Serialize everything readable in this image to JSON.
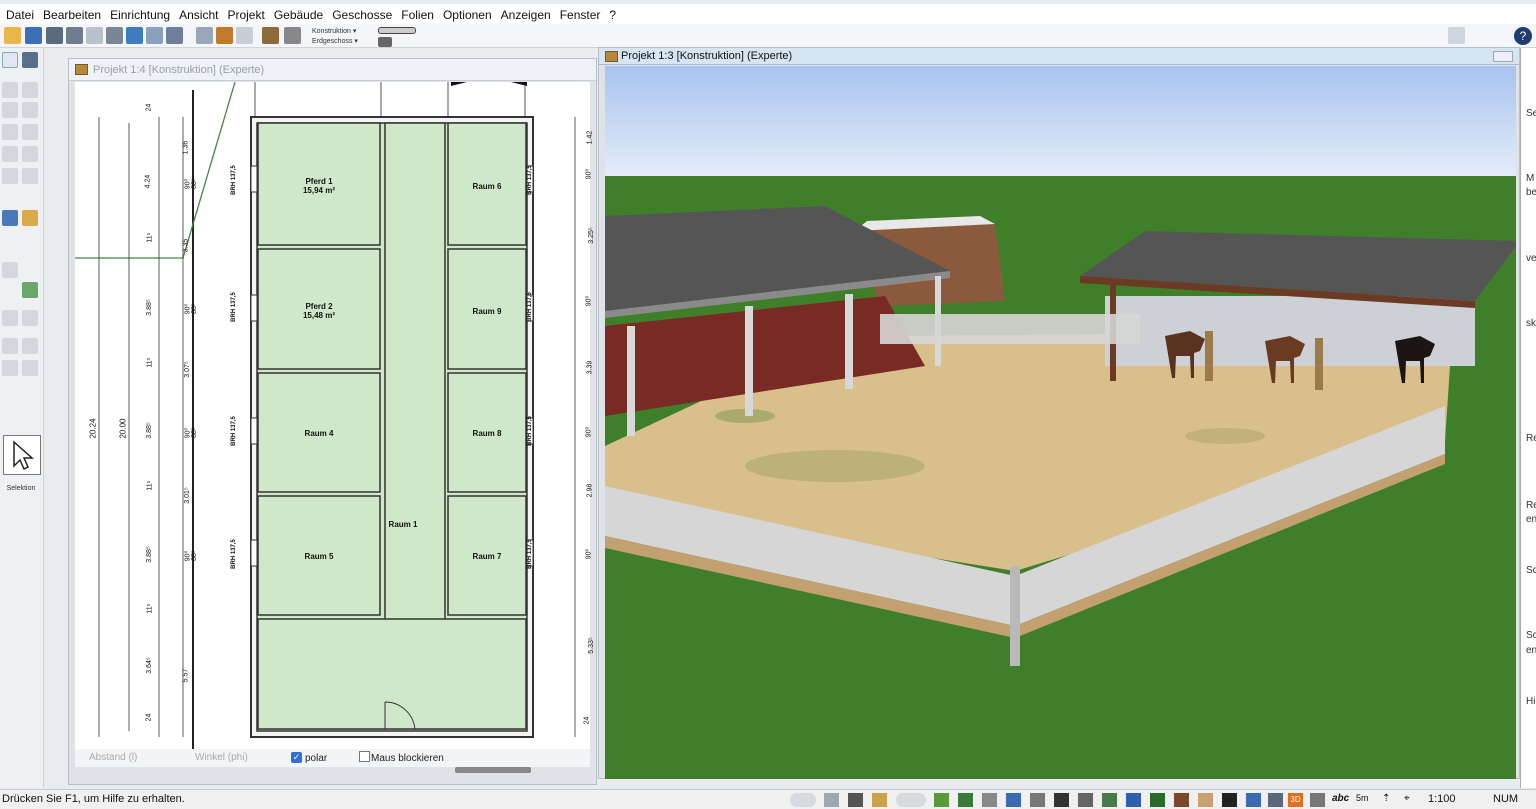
{
  "menu": [
    "Datei",
    "Bearbeiten",
    "Einrichtung",
    "Ansicht",
    "Projekt",
    "Gebäude",
    "Geschosse",
    "Folien",
    "Optionen",
    "Anzeigen",
    "Fenster",
    "?"
  ],
  "toolbar": {
    "layer_select": "Konstruktion",
    "floor_select": "Erdgeschoss"
  },
  "left_tools": {
    "selection_label": "Selektion"
  },
  "window_2d": {
    "title": "Projekt 1:4 [Konstruktion] (Experte)",
    "rooms": [
      {
        "name": "Pferd 1",
        "area": "15,94 m²"
      },
      {
        "name": "Pferd 2",
        "area": "15,48 m²"
      },
      {
        "name": "Raum 4"
      },
      {
        "name": "Raum 5"
      },
      {
        "name": "Raum 6"
      },
      {
        "name": "Raum 9"
      },
      {
        "name": "Raum 8"
      },
      {
        "name": "Raum 7"
      },
      {
        "name": "Raum 1"
      }
    ],
    "window_tag": "BRH 137,5",
    "dimensions_left": {
      "total_outer": "20.24",
      "total_inner": "20.00",
      "chain": [
        "24",
        "4.24",
        "11⁵",
        "3.88⁵",
        "11⁵",
        "3.88⁵",
        "11⁵",
        "3.88⁵",
        "11⁵",
        "3.64⁵",
        "24"
      ],
      "chain2": [
        "1.36",
        "90⁰",
        "88⁵",
        "3.35",
        "90⁰",
        "88⁵",
        "3.07⁵",
        "90⁰",
        "88⁵",
        "3.01⁵",
        "90⁰",
        "88⁵",
        "5.57"
      ]
    },
    "dimensions_right": [
      "1.42",
      "90⁰",
      "3.25⁵",
      "90⁰",
      "3.39",
      "90⁰",
      "2.98",
      "90⁰",
      "5.33⁵",
      "24"
    ],
    "status": {
      "distance_label": "Abstand (l)",
      "angle_label": "Winkel (phi)",
      "polar_label": "polar",
      "polar_checked": true,
      "mouse_lock_label": "Maus blockieren",
      "mouse_lock_checked": false
    }
  },
  "window_3d": {
    "title": "Projekt 1:3 [Konstruktion] (Experte)"
  },
  "right_panel": {
    "labels": [
      "Se",
      "M",
      "be",
      "ve",
      "sk",
      "Re",
      "Re",
      "en",
      "Sc",
      "Sc",
      "en",
      "Hi"
    ]
  },
  "statusbar": {
    "help_text": "Drücken Sie F1, um Hilfe zu erhalten.",
    "scale": "1:100",
    "num": "NUM",
    "icon_texts": {
      "three_d": "3D",
      "abc": "abc",
      "five_m": "5m"
    }
  },
  "colors": {
    "room_fill": "#cfe8c9",
    "wall": "#444444",
    "grass": "#3f7f2a",
    "sand": "#d9bf8c",
    "sky": "#c8daf5",
    "fence": "#d6d6d6",
    "roof": "#4c4c4c"
  }
}
